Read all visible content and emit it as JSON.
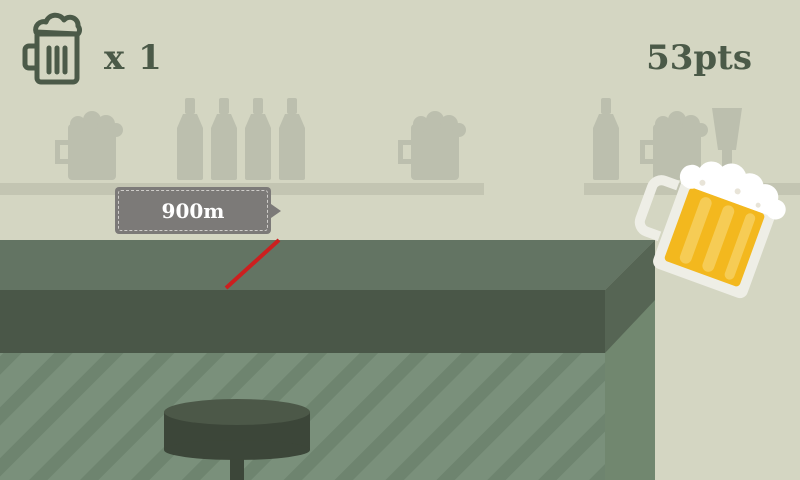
{
  "hud": {
    "mug_count_label": "x 1",
    "score_label": "53pts",
    "mug_icon": "beer-mug-icon"
  },
  "distance_marker": {
    "label": "900m"
  },
  "colors": {
    "background": "#d4d6c2",
    "hud_text": "#4b5a48",
    "shelf_items": "#bcbfae",
    "counter_top": "#637463",
    "counter_front": "#4a5748",
    "counter_base": "#7a907b",
    "counter_stripes": "#6e846f",
    "stool": "#3c4639",
    "finish_line": "#cc1f1f",
    "tag": "#7c7a78",
    "beer": "#f3b81e",
    "foam": "#ffffff"
  }
}
